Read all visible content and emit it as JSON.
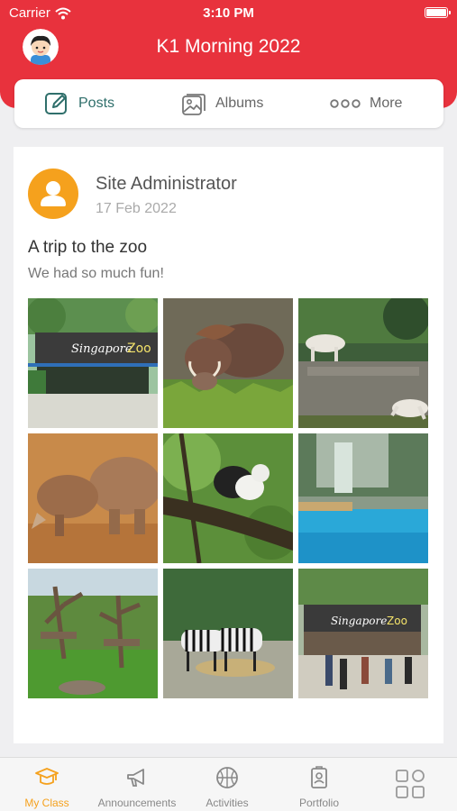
{
  "status_bar": {
    "carrier": "Carrier",
    "time": "3:10 PM"
  },
  "header": {
    "title": "K1 Morning 2022"
  },
  "tabs": [
    {
      "label": "Posts",
      "icon": "edit-icon",
      "active": true
    },
    {
      "label": "Albums",
      "icon": "photo-album-icon",
      "active": false
    },
    {
      "label": "More",
      "icon": "more-dots-icon",
      "active": false
    }
  ],
  "post": {
    "author": "Site Administrator",
    "date": "17 Feb 2022",
    "title": "A trip to the zoo",
    "body": "We had so much fun!",
    "photos": [
      {
        "subject": "zoo entrance"
      },
      {
        "subject": "warthog"
      },
      {
        "subject": "white tigers"
      },
      {
        "subject": "rhinos"
      },
      {
        "subject": "monkey on branch"
      },
      {
        "subject": "waterfall pool"
      },
      {
        "subject": "ape enclosure"
      },
      {
        "subject": "zebras"
      },
      {
        "subject": "zoo entrance crowd"
      }
    ]
  },
  "bottom_nav": [
    {
      "label": "My Class",
      "icon": "graduation-cap-icon",
      "active": true
    },
    {
      "label": "Announcements",
      "icon": "megaphone-icon",
      "active": false
    },
    {
      "label": "Activities",
      "icon": "basketball-icon",
      "active": false
    },
    {
      "label": "Portfolio",
      "icon": "portfolio-icon",
      "active": false
    },
    {
      "label": "",
      "icon": "apps-grid-icon",
      "active": false
    }
  ],
  "colors": {
    "brand_red": "#e8323d",
    "accent_orange": "#f5a11d",
    "active_tab": "#2f6f6b"
  }
}
